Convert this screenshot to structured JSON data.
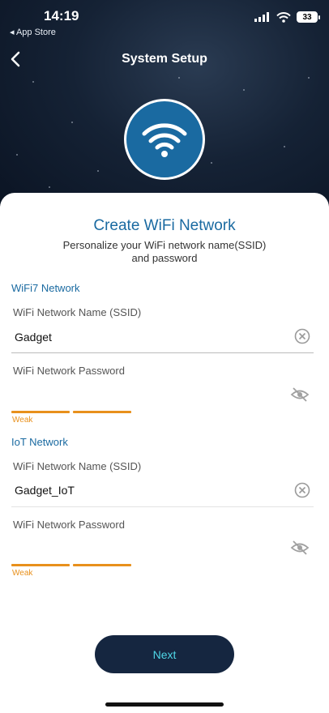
{
  "status_bar": {
    "time": "14:19",
    "back_app": "◂ App Store",
    "battery": "33"
  },
  "navbar": {
    "title": "System Setup"
  },
  "header_icon": "wifi-icon",
  "sheet": {
    "title": "Create WiFi Network",
    "subtitle_line1": "Personalize your WiFi network name(SSID)",
    "subtitle_line2": "and password"
  },
  "wifi7": {
    "section_title": "WiFi7 Network",
    "ssid_label": "WiFi Network Name (SSID)",
    "ssid_value": "Gadget",
    "password_label": "WiFi Network Password",
    "password_value": "",
    "strength_label": "Weak"
  },
  "iot": {
    "section_title": "IoT Network",
    "ssid_label": "WiFi Network Name (SSID)",
    "ssid_value": "Gadget_IoT",
    "password_label": "WiFi Network Password",
    "password_value": "",
    "strength_label": "Weak"
  },
  "next_label": "Next",
  "colors": {
    "accent": "#1a6aa1",
    "warning": "#e8901c",
    "button_bg": "#152640",
    "button_text": "#4fd6e6"
  }
}
